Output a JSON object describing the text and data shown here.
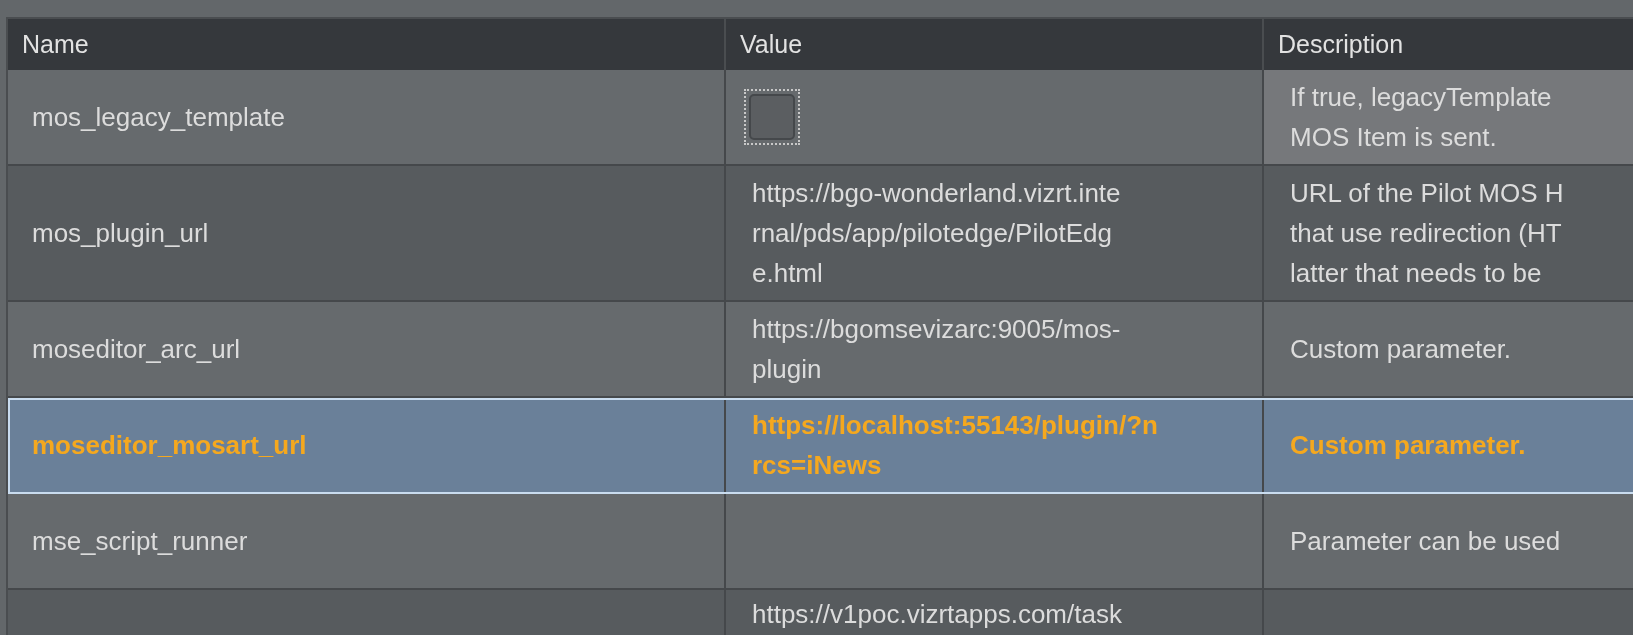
{
  "table": {
    "columns": [
      "Name",
      "Value",
      "Description"
    ],
    "rows": [
      {
        "name": "mos_legacy_template",
        "value": {
          "kind": "checkbox",
          "checked": false
        },
        "description": [
          "If true, legacyTemplate",
          "MOS Item is sent."
        ],
        "selected": false
      },
      {
        "name": "mos_plugin_url",
        "value": {
          "kind": "text",
          "lines": [
            "https://bgo-wonderland.vizrt.inte",
            "rnal/pds/app/pilotedge/PilotEdg",
            "e.html"
          ]
        },
        "description": [
          "URL of the Pilot MOS H",
          "that use redirection (HT",
          "latter that needs to be"
        ],
        "selected": false
      },
      {
        "name": "moseditor_arc_url",
        "value": {
          "kind": "text",
          "lines": [
            "https://bgomsevizarc:9005/mos-",
            "plugin"
          ]
        },
        "description": [
          "Custom parameter."
        ],
        "selected": false
      },
      {
        "name": "moseditor_mosart_url",
        "value": {
          "kind": "text",
          "lines": [
            "https://localhost:55143/plugin/?n",
            "rcs=iNews"
          ]
        },
        "description": [
          "Custom parameter."
        ],
        "selected": true
      },
      {
        "name": "mse_script_runner",
        "description": [
          "Parameter can be used"
        ],
        "selected": false
      },
      {
        "value": {
          "kind": "text",
          "lines": [
            "https://v1poc.vizrtapps.com/task"
          ]
        },
        "selected": false
      }
    ]
  }
}
